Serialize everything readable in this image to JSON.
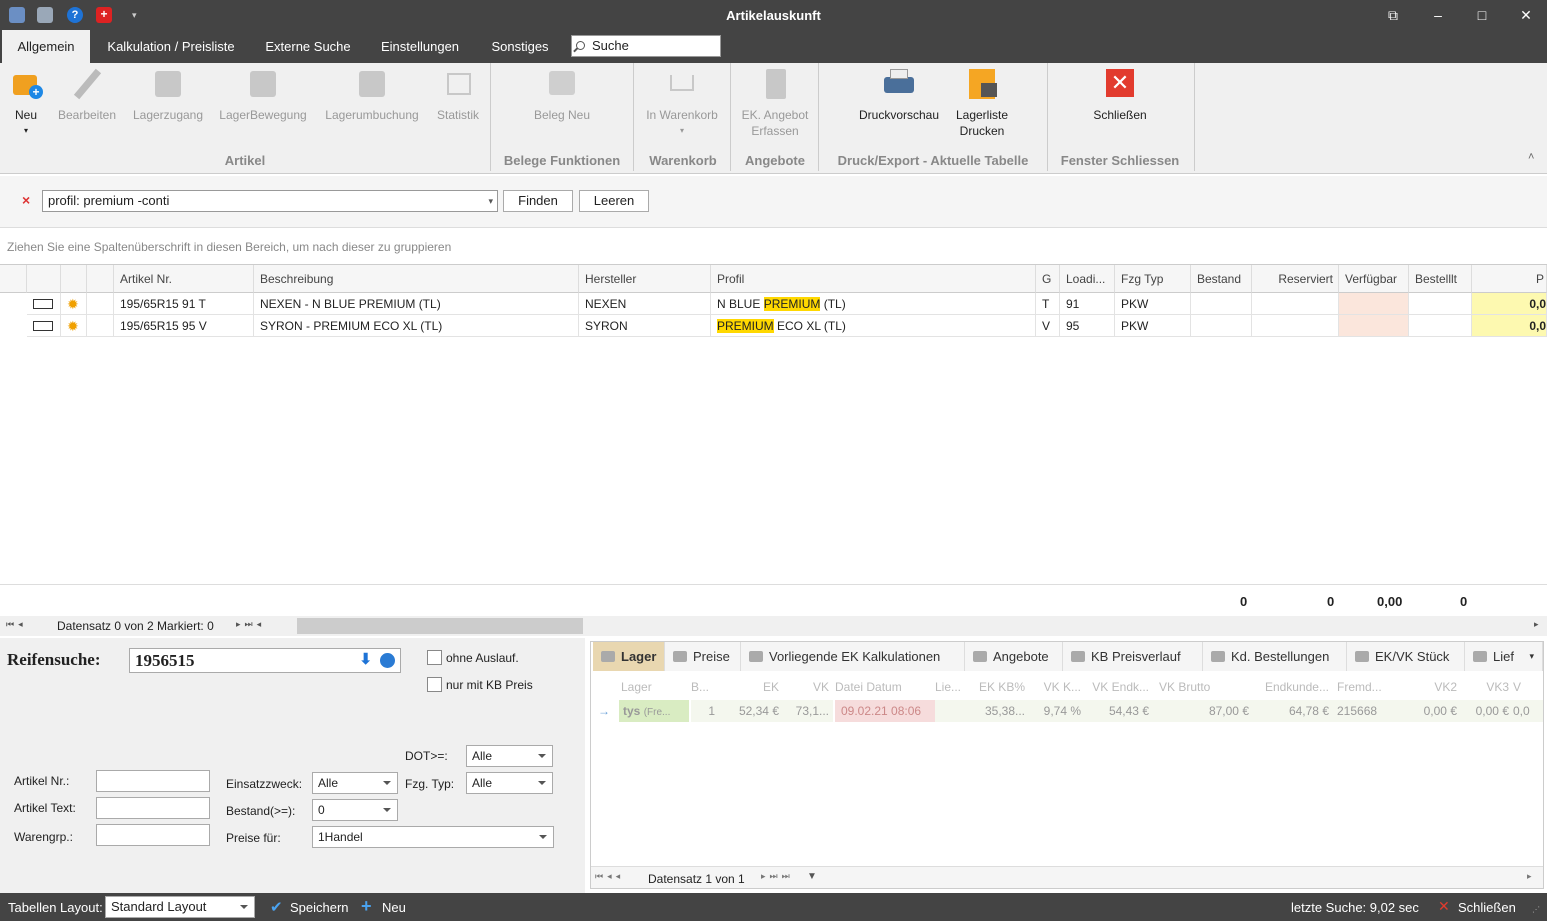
{
  "window": {
    "title": "Artikelauskunft"
  },
  "tabs": [
    "Allgemein",
    "Kalkulation / Preisliste",
    "Externe Suche",
    "Einstellungen",
    "Sonstiges"
  ],
  "search": {
    "placeholder": "Suche"
  },
  "ribbon": {
    "buttons": [
      "Neu",
      "Bearbeiten",
      "Lagerzugang",
      "LagerBewegung",
      "Lagerumbuchung",
      "Statistik",
      "Beleg Neu",
      "In Warenkorb",
      "EK. Angebot Erfassen",
      "Druckvorschau",
      "Lagerliste Drucken",
      "Schließen"
    ],
    "groups": [
      "Artikel",
      "Belege Funktionen",
      "Warenkorb",
      "Angebote",
      "Druck/Export - Aktuelle Tabelle",
      "Fenster Schliessen"
    ]
  },
  "filter": {
    "clear": "×",
    "query": "profil: premium -conti",
    "find": "Finden",
    "clear_btn": "Leeren"
  },
  "group_hint": "Ziehen Sie eine Spaltenüberschrift in diesen Bereich, um nach dieser zu gruppieren",
  "grid": {
    "columns": [
      "Artikel Nr.",
      "Beschreibung",
      "Hersteller",
      "Profil",
      "G",
      "Loadi...",
      "Fzg Typ",
      "Bestand",
      "Reserviert",
      "Verfügbar",
      "Bestelllt",
      "P"
    ],
    "rows": [
      {
        "artikel": "195/65R15 91 T",
        "beschreibung": "NEXEN - N BLUE PREMIUM (TL)",
        "hersteller": "NEXEN",
        "profil_pre": "N BLUE ",
        "profil_hl": "PREMIUM",
        "profil_post": " (TL)",
        "g": "T",
        "load": "91",
        "fzg": "PKW",
        "p": "0,0"
      },
      {
        "artikel": "195/65R15 95 V",
        "beschreibung": "SYRON - PREMIUM ECO XL (TL)",
        "hersteller": "SYRON",
        "profil_pre": "",
        "profil_hl": "PREMIUM",
        "profil_post": " ECO XL (TL)",
        "g": "V",
        "load": "95",
        "fzg": "PKW",
        "p": "0,0"
      }
    ],
    "totals": {
      "bestand": "0",
      "reserviert": "0",
      "verfuegbar": "0,00",
      "bestellt": "0"
    },
    "nav": "Datensatz 0 von 2 Markiert: 0"
  },
  "reifensuche": {
    "label": "Reifensuche:",
    "value": "1956515",
    "ohne_auslauf": "ohne Auslauf.",
    "nur_kb": "nur mit KB Preis",
    "dot_label": "DOT>=:",
    "dot_value": "Alle",
    "artikel_nr": "Artikel Nr.:",
    "artikel_text": "Artikel Text:",
    "warengrp": "Warengrp.:",
    "einsatz_label": "Einsatzzweck:",
    "einsatz_value": "Alle",
    "fzg_label": "Fzg. Typ:",
    "fzg_value": "Alle",
    "bestand_label": "Bestand(>=):",
    "bestand_value": "0",
    "preise_label": "Preise für:",
    "preise_value": "1Handel"
  },
  "lower": {
    "tabs": [
      "Lager",
      "Preise",
      "Vorliegende EK Kalkulationen",
      "Angebote",
      "KB Preisverlauf",
      "Kd. Bestellungen",
      "EK/VK Stück",
      "Lief"
    ],
    "columns": [
      "Lager",
      "B...",
      "EK",
      "VK",
      "Datei Datum",
      "Lie...",
      "EK KB%",
      "VK K...",
      "VK Endk...",
      "VK Brutto",
      "Endkunde...",
      "Fremd...",
      "VK2",
      "VK3",
      "V"
    ],
    "row": {
      "lager": "tys",
      "lager_sub": "(Fre...",
      "b": "1",
      "ek": "52,34 €",
      "vk": "73,1...",
      "datum": "09.02.21 08:06",
      "lie": "",
      "ekkb": "35,38...",
      "vkk": "9,74 %",
      "vkend": "54,43 €",
      "vkbrutto": "87,00 €",
      "endkunde": "64,78 €",
      "fremd": "215668",
      "vk2": "0,00 €",
      "vk3": "0,00 €",
      "v": "0,0"
    },
    "nav": "Datensatz 1 von 1"
  },
  "status": {
    "layout_label": "Tabellen Layout:",
    "layout_value": "Standard Layout",
    "save": "Speichern",
    "new": "Neu",
    "last_search": "letzte Suche: 9,02 sec",
    "close": "Schließen"
  }
}
